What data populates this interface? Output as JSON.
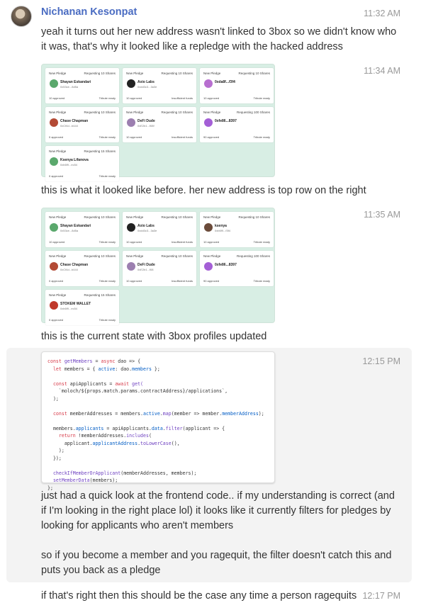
{
  "author": "Nichanan Kesonpat",
  "messages": [
    {
      "time": "11:32 AM",
      "text": "yeah it turns out her new address wasn't linked to 3box so we didn't know who it was, that's why it looked like a repledge with the hacked address"
    },
    {
      "time": "11:34 AM",
      "text": "this is what it looked like before. her new address is top row on the right"
    },
    {
      "time": "11:35 AM",
      "text": "this is the current state with 3box profiles updated"
    },
    {
      "time": "12:15 PM",
      "text_1": "just had a quick look at the frontend code.. if my understanding is correct (and if I'm looking in the right place lol) it looks like it currently filters for pledges by looking for applicants who aren't members",
      "text_2": "so if you become a member and you ragequit, the filter doesn't catch this and puts you back as a pledge"
    },
    {
      "time": "12:17 PM",
      "text": "if that's right then this should be the case any time a person ragequits"
    }
  ],
  "shot1_cards": [
    {
      "head_left": "New Pledge",
      "head_right": "Requesting 10 Shares",
      "name": "Shayan Eskandari",
      "addr": "0x53ce...8d5a",
      "foot_left": "10 approved",
      "foot_right": "Tribute ready",
      "color": "#5aa86c"
    },
    {
      "head_left": "New Pledge",
      "head_right": "Requesting 10 Shares",
      "name": "Axio Labs",
      "addr": "0xdd3c3...3a3e",
      "foot_left": "10 approved",
      "foot_right": "Insufficient funds",
      "color": "#222222"
    },
    {
      "head_left": "New Pledge",
      "head_right": "Requesting 10 Shares",
      "name": "0xda8f...f3f4",
      "addr": "",
      "foot_left": "10 approved",
      "foot_right": "Tribute ready",
      "color": "#b86fd0"
    },
    {
      "head_left": "New Pledge",
      "head_right": "Requesting 10 Shares",
      "name": "Chase Chapman",
      "addr": "0xCf4d...b444",
      "foot_left": "0 approved",
      "foot_right": "Tribute ready",
      "color": "#b34a35"
    },
    {
      "head_left": "New Pledge",
      "head_right": "Requesting 10 Shares",
      "name": "DeFi Dude",
      "addr": "0xE2b1...f08f",
      "foot_left": "10 approved",
      "foot_right": "Insufficient funds",
      "color": "#9c7fb0"
    },
    {
      "head_left": "New Pledge",
      "head_right": "Requesting 100 Shares",
      "name": "0xfe86...8397",
      "addr": "",
      "foot_left": "90 approved",
      "foot_right": "Tribute ready",
      "color": "#a45fd6"
    },
    {
      "head_left": "New Pledge",
      "head_right": "Requesting 15 Shares",
      "name": "Ksenya Lifanova",
      "addr": "0xb6f9...ec54",
      "foot_left": "0 approved",
      "foot_right": "Tribute ready",
      "color": "#5aa86c"
    }
  ],
  "shot2_cards": [
    {
      "head_left": "New Pledge",
      "head_right": "Requesting 10 Shares",
      "name": "Shayan Eskandari",
      "addr": "0x53ce...8d5a",
      "foot_left": "10 approved",
      "foot_right": "Tribute ready",
      "color": "#5aa86c"
    },
    {
      "head_left": "New Pledge",
      "head_right": "Requesting 10 Shares",
      "name": "Axio Labs",
      "addr": "0xdd3c3...3a3e",
      "foot_left": "10 approved",
      "foot_right": "Insufficient funds",
      "color": "#222222"
    },
    {
      "head_left": "New Pledge",
      "head_right": "Requesting 10 Shares",
      "name": "ksenya",
      "addr": "0xb6f9...f3f4",
      "foot_left": "10 approved",
      "foot_right": "Tribute ready",
      "color": "#6b4b3a"
    },
    {
      "head_left": "New Pledge",
      "head_right": "Requesting 10 Shares",
      "name": "Chase Chapman",
      "addr": "0xCf4d...b444",
      "foot_left": "0 approved",
      "foot_right": "Tribute ready",
      "color": "#b34a35"
    },
    {
      "head_left": "New Pledge",
      "head_right": "Requesting 10 Shares",
      "name": "DeFi Dude",
      "addr": "0xE2b1...f08",
      "foot_left": "10 approved",
      "foot_right": "Insufficient funds",
      "color": "#9c7fb0"
    },
    {
      "head_left": "New Pledge",
      "head_right": "Requesting 100 Shares",
      "name": "0xfe86...8397",
      "addr": "",
      "foot_left": "90 approved",
      "foot_right": "Tribute ready",
      "color": "#a45fd6"
    },
    {
      "head_left": "New Pledge",
      "head_right": "Requesting 15 Shares",
      "name": "STOKEM WALLET",
      "addr": "0xb6f9...ec54",
      "foot_left": "0 approved",
      "foot_right": "Tribute ready",
      "color": "#c0392b"
    }
  ],
  "code": {
    "l1a": "const ",
    "l1b": "getMembers",
    "l1c": " = ",
    "l1d": "async",
    "l1e": " dao => {",
    "l2a": "  let ",
    "l2b": "members = { ",
    "l2c": "active",
    "l2d": ": dao.",
    "l2e": "members",
    "l2f": " };",
    "l3a": "  const ",
    "l3b": "apiApplicants = ",
    "l3c": "await",
    "l3d": " get(",
    "l4": "    `moloch/${props.match.params.contractAddress}/applications`,",
    "l5": "  );",
    "l6a": "  const ",
    "l6b": "memberAddresses = members.",
    "l6c": "active",
    "l6d": ".",
    "l6e": "map",
    "l6f": "(member => member.",
    "l6g": "memberAddress",
    "l6h": ");",
    "l7a": "  members.",
    "l7b": "applicants",
    "l7c": " = apiApplicants.",
    "l7d": "data",
    "l7e": ".",
    "l7f": "filter",
    "l7g": "(applicant => {",
    "l8a": "    return ",
    "l8b": "!memberAddresses.",
    "l8c": "includes",
    "l8d": "(",
    "l9a": "      applicant.",
    "l9b": "applicantAddress",
    "l9c": ".",
    "l9d": "toLowerCase",
    "l9e": "(),",
    "l10": "    );",
    "l11": "  });",
    "l12a": "  checkIfMemberOrApplicant",
    "l12b": "(memberAddresses, members);",
    "l13a": "  setMemberData",
    "l13b": "(members);",
    "l14": "};"
  }
}
